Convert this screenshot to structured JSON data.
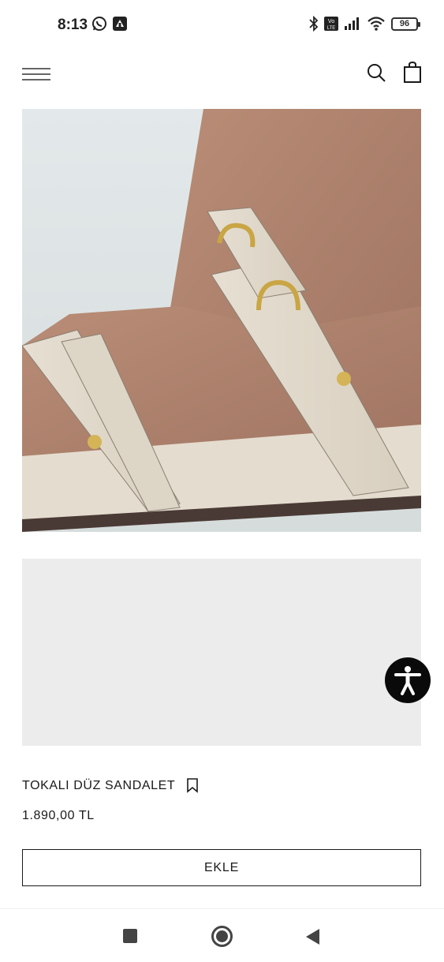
{
  "status_bar": {
    "time": "8:13",
    "icons_left": [
      "whatsapp-icon",
      "notification-app-icon"
    ],
    "icons_right": [
      "bluetooth-icon",
      "volte-icon",
      "signal-icon",
      "wifi-icon",
      "battery-icon"
    ],
    "battery": "96"
  },
  "header": {
    "icons": [
      "menu-icon",
      "search-icon",
      "shopping-bag-icon"
    ]
  },
  "product": {
    "name": "TOKALI DÜZ SANDALET",
    "price": "1.890,00 TL",
    "add_label": "EKLE"
  },
  "colors": {
    "background": "#ffffff",
    "text": "#1a1a1a",
    "accessibility_button": "#0a0a0a",
    "image_placeholder": "#ececec"
  },
  "nav_bar": {
    "icons": [
      "recent-apps-icon",
      "home-icon",
      "back-icon"
    ]
  }
}
